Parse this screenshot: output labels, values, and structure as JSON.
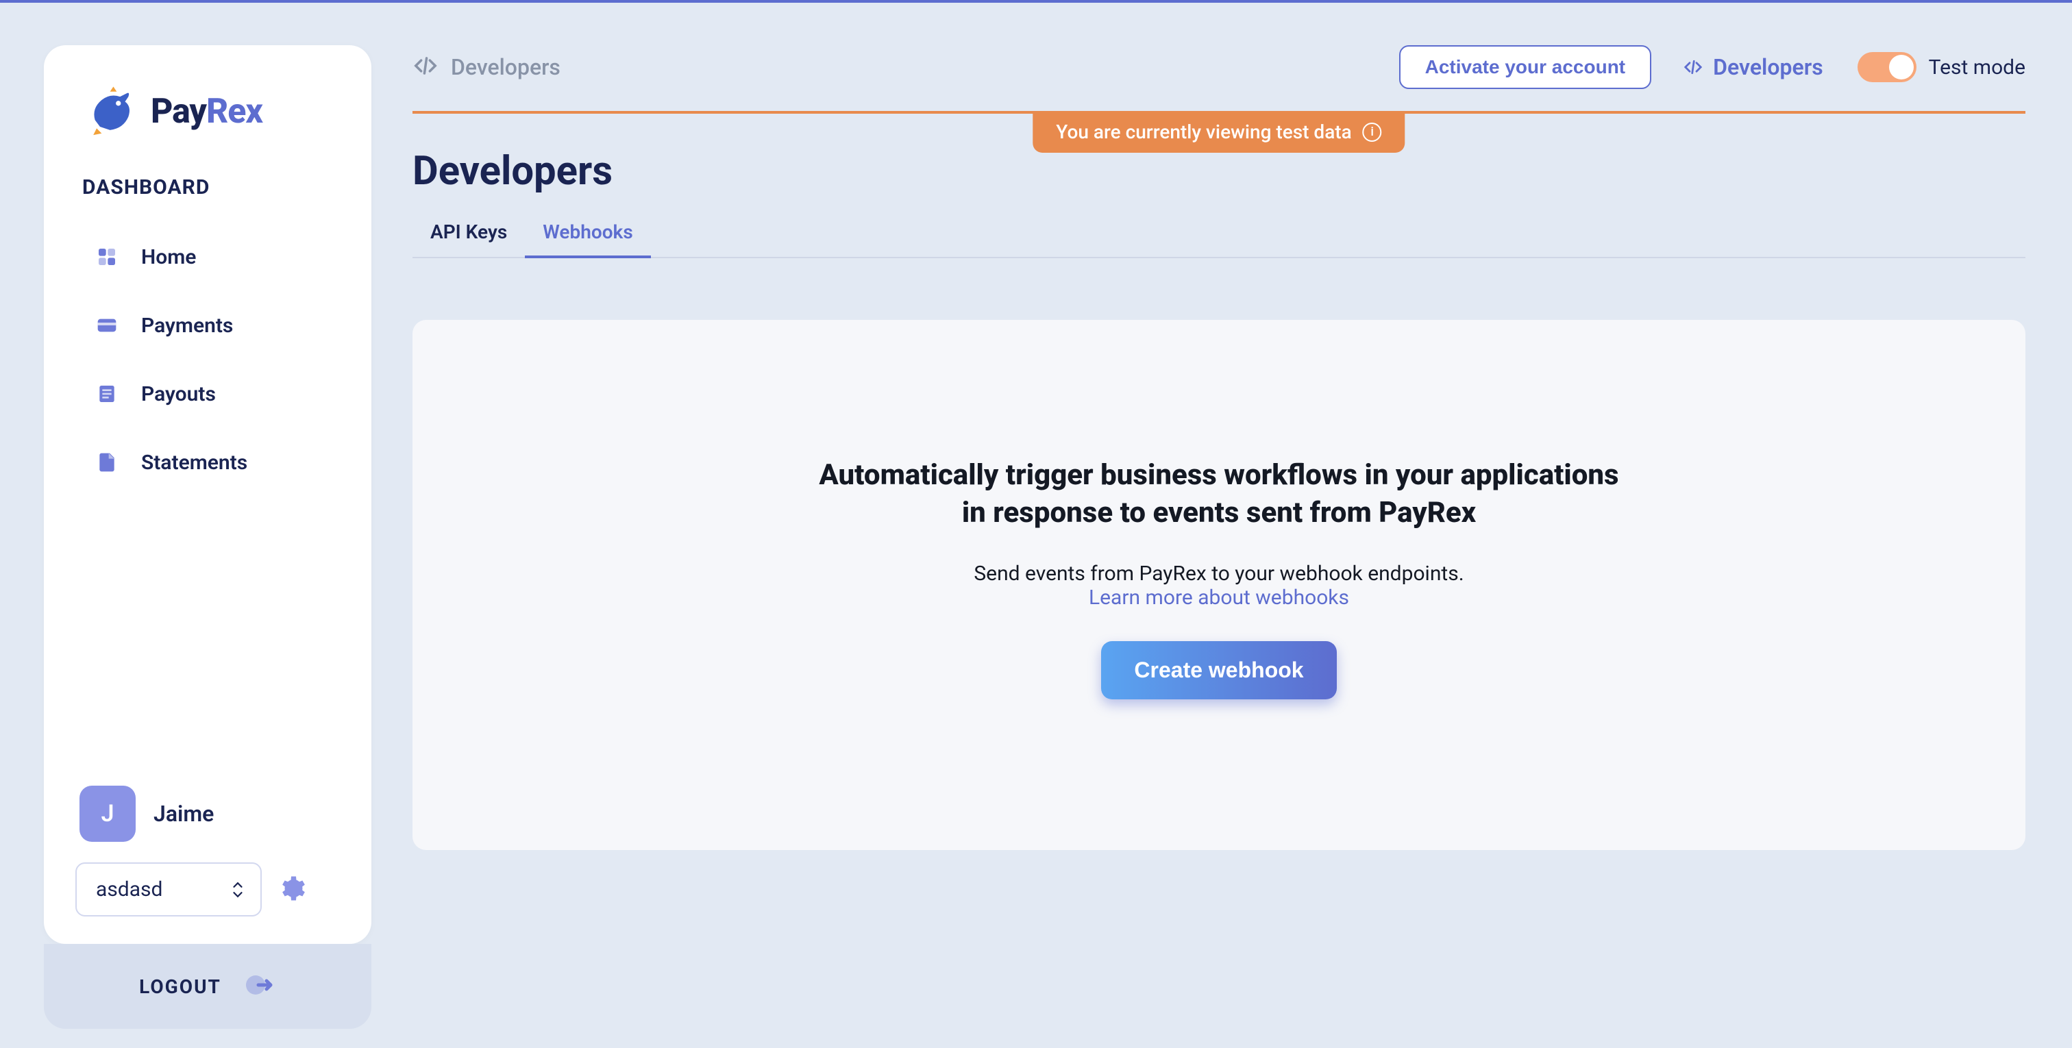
{
  "brand": {
    "pay": "Pay",
    "rex": "Rex"
  },
  "sidebar": {
    "section": "DASHBOARD",
    "items": [
      {
        "label": "Home"
      },
      {
        "label": "Payments"
      },
      {
        "label": "Payouts"
      },
      {
        "label": "Statements"
      }
    ],
    "user": {
      "initial": "J",
      "name": "Jaime"
    },
    "project_select": {
      "value": "asdasd"
    },
    "logout": "LOGOUT"
  },
  "topbar": {
    "breadcrumb": "Developers",
    "activate": "Activate your account",
    "dev_link": "Developers",
    "test_mode_label": "Test mode"
  },
  "banner": {
    "text": "You are currently viewing test data"
  },
  "page": {
    "title": "Developers",
    "tabs": [
      {
        "label": "API Keys"
      },
      {
        "label": "Webhooks"
      }
    ]
  },
  "card": {
    "heading": "Automatically trigger business workflows in your applications in response to events sent from PayRex",
    "sub": "Send events from PayRex to your webhook endpoints.",
    "link": "Learn more about webhooks",
    "cta": "Create webhook"
  }
}
